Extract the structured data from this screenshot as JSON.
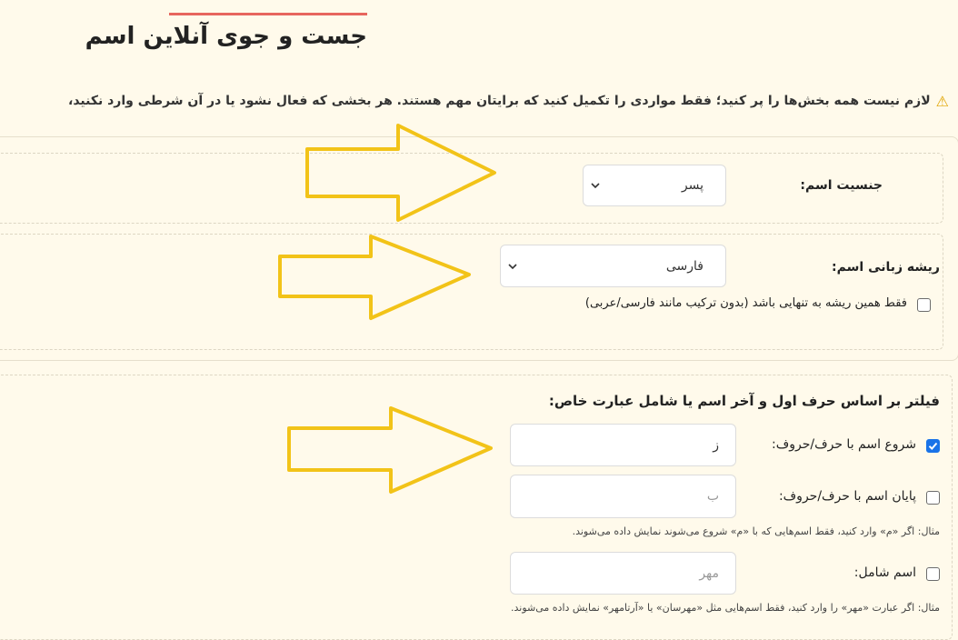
{
  "page": {
    "title": "جست و جوی آنلاین اسم",
    "notice": "لازم نیست همه بخش‌ها را پر کنید؛ فقط مواردی را تکمیل کنید که برایتان مهم هستند. هر بخشی که فعال نشود یا در آن شرطی وارد نکنید،"
  },
  "gender": {
    "label": "جنسیت اسم:",
    "selected": "پسر"
  },
  "origin": {
    "label": "ریشه زبانی اسم:",
    "selected": "فارسی",
    "only_label": "فقط همین ریشه به تنهایی باشد (بدون ترکیب مانند فارسی/عربی)",
    "only_checked": false
  },
  "filter": {
    "heading": "فیلتر بر اساس حرف اول و آخر اسم یا شامل عبارت خاص:",
    "start": {
      "label": "شروع اسم با حرف/حروف:",
      "value": "ز",
      "checked": true
    },
    "end": {
      "label": "پایان اسم با حرف/حروف:",
      "placeholder": "ب",
      "checked": false
    },
    "end_hint": "مثال: اگر «م» وارد کنید، فقط اسم‌هایی که با «م» شروع می‌شوند نمایش داده می‌شوند.",
    "contains": {
      "label": "اسم شامل:",
      "placeholder": "مهر",
      "checked": false
    },
    "contains_hint": "مثال: اگر عبارت «مهر» را وارد کنید، فقط اسم‌هایی مثل «مهرسان» یا «آرتامهر» نمایش داده می‌شوند."
  },
  "icons": {
    "warning": "warning-icon",
    "chevron": "chevron-down-icon",
    "check": "check-icon",
    "arrow": "arrow-right-annotation-icon"
  },
  "colors": {
    "background": "#fffaeb",
    "accent_underline": "#e7665e",
    "checkbox_checked": "#1a73e8",
    "annotation_arrow": "#f2c318"
  }
}
